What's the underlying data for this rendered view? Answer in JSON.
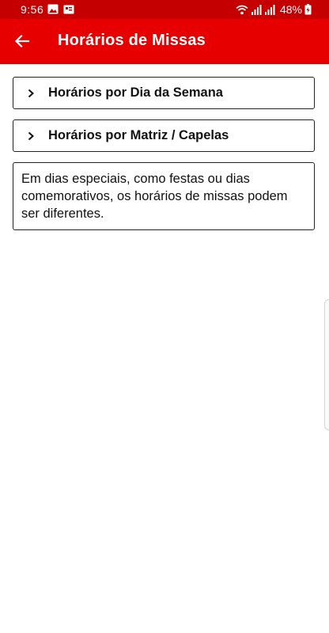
{
  "status_bar": {
    "time": "9:56",
    "battery": "48%",
    "icons": [
      "image-icon",
      "notification-icon",
      "wifi-icon",
      "signal-icon",
      "signal-icon",
      "battery-icon"
    ]
  },
  "app_bar": {
    "title": "Horários de Missas",
    "back_icon": "arrow-left-icon",
    "color": "#e60000"
  },
  "sections": [
    {
      "label": "Horários por Dia da Semana",
      "icon": "chevron-right-icon"
    },
    {
      "label": "Horários por Matriz / Capelas",
      "icon": "chevron-right-icon"
    }
  ],
  "note": "Em dias especiais, como festas ou dias comemorativos, os horários de missas podem ser diferentes."
}
